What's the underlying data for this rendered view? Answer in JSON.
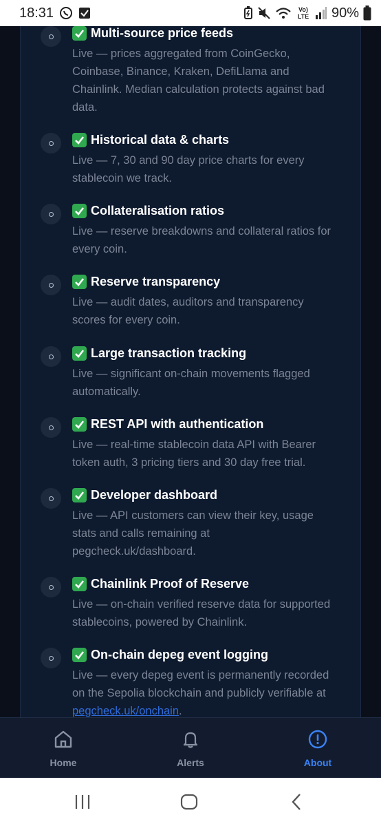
{
  "status_bar": {
    "time": "18:31",
    "network": "Vo) LTE",
    "battery": "90%"
  },
  "items": [
    {
      "title": "Multi-source price feeds",
      "lines": [
        "Live — prices aggregated from CoinGecko,",
        "Coinbase, Binance, Kraken, DefiLlama and",
        "Chainlink. Median calculation protects against bad",
        "data."
      ]
    },
    {
      "title": "Historical data & charts",
      "lines": [
        "Live — 7, 30 and 90 day price charts for every",
        "stablecoin we track."
      ]
    },
    {
      "title": "Collateralisation ratios",
      "lines": [
        "Live — reserve breakdowns and collateral ratios for",
        "every coin."
      ]
    },
    {
      "title": "Reserve transparency",
      "lines": [
        "Live — audit dates, auditors and transparency",
        "scores for every coin."
      ]
    },
    {
      "title": "Large transaction tracking",
      "lines": [
        "Live — significant on-chain movements flagged",
        "automatically."
      ]
    },
    {
      "title": "REST API with authentication",
      "lines": [
        "Live — real-time stablecoin data API with Bearer",
        "token auth, 3 pricing tiers and 30 day free trial."
      ]
    },
    {
      "title": "Developer dashboard",
      "lines": [
        "Live — API customers can view their key, usage",
        "stats and calls remaining at",
        "pegcheck.uk/dashboard."
      ]
    },
    {
      "title": "Chainlink Proof of Reserve",
      "lines": [
        "Live — on-chain verified reserve data for supported",
        "stablecoins, powered by Chainlink."
      ]
    },
    {
      "title": "On-chain depeg event logging",
      "lines": [
        "Live — every depeg event is permanently recorded",
        "on the Sepolia blockchain and publicly verifiable at"
      ],
      "link": "pegcheck.uk/onchain",
      "link_suffix": "."
    }
  ],
  "bottom_nav": [
    {
      "label": "Home",
      "icon": "home-icon",
      "active": false
    },
    {
      "label": "Alerts",
      "icon": "bell-icon",
      "active": false
    },
    {
      "label": "About",
      "icon": "info-icon",
      "active": true
    }
  ],
  "colors": {
    "active": "#3b82f6",
    "inactive": "#8a93a4",
    "check": "#2fa84f",
    "link": "#2f6bd8"
  }
}
